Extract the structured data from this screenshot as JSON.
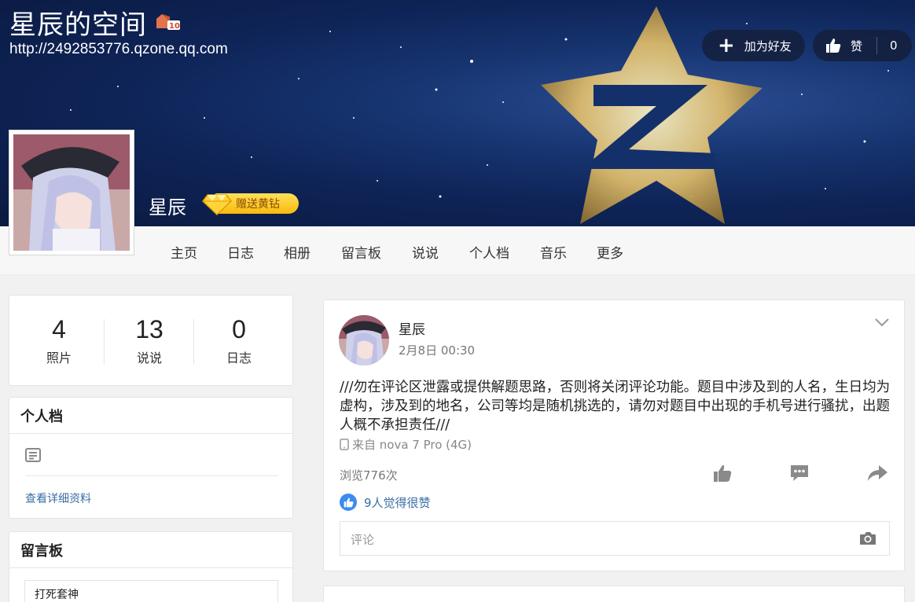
{
  "header": {
    "space_title": "星辰的空间",
    "url": "http://2492853776.qzone.qq.com",
    "level": "10",
    "add_friend_label": "加为好友",
    "like_label": "赞",
    "like_count": "0",
    "owner_name": "星辰",
    "vip_label": "赠送黄钻"
  },
  "nav": [
    "主页",
    "日志",
    "相册",
    "留言板",
    "说说",
    "个人档",
    "音乐",
    "更多"
  ],
  "stats": [
    {
      "value": "4",
      "label": "照片"
    },
    {
      "value": "13",
      "label": "说说"
    },
    {
      "value": "0",
      "label": "日志"
    }
  ],
  "profile": {
    "title": "个人档",
    "more_link": "查看详细资料"
  },
  "message_board": {
    "title": "留言板",
    "entry": "打死套神"
  },
  "post": {
    "author": "星辰",
    "time": "2月8日 00:30",
    "text": "///勿在评论区泄露或提供解题思路，否则将关闭评论功能。题目中涉及到的人名，生日均为虚构，涉及到的地名，公司等均是随机挑选的，请勿对题目中出现的手机号进行骚扰，出题人概不承担责任///",
    "device": "来自 nova 7 Pro (4G)",
    "views": "浏览776次",
    "likes_text": "9人觉得很赞",
    "comment_placeholder": "评论"
  },
  "colors": {
    "link": "#3a6ea5",
    "like_badge": "#3b8cf1",
    "vip_gold": "#f9b90d",
    "banner_dark": "#0e2356"
  }
}
